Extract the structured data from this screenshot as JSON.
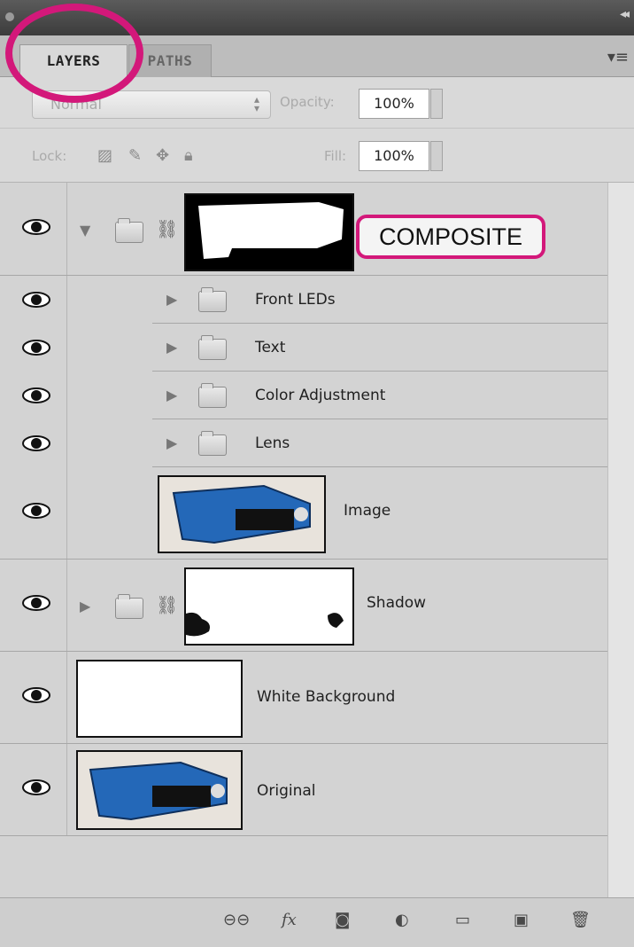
{
  "tabs": [
    {
      "label": "LAYERS"
    },
    {
      "label": "PATHS"
    }
  ],
  "blend_mode": "Normal",
  "opacity": {
    "label": "Opacity:",
    "value": "100%"
  },
  "lock": {
    "label": "Lock:"
  },
  "fill": {
    "label": "Fill:",
    "value": "100%"
  },
  "annotation_label": "COMPOSITE",
  "layers": [
    {
      "name": "Front LEDs"
    },
    {
      "name": "Text"
    },
    {
      "name": "Color Adjustment"
    },
    {
      "name": "Lens"
    },
    {
      "name": "Image"
    },
    {
      "name": "Shadow"
    },
    {
      "name": "White Background"
    },
    {
      "name": "Original"
    }
  ],
  "colors": {
    "annotation": "#d3187a",
    "camera_body": "#2468b8"
  }
}
